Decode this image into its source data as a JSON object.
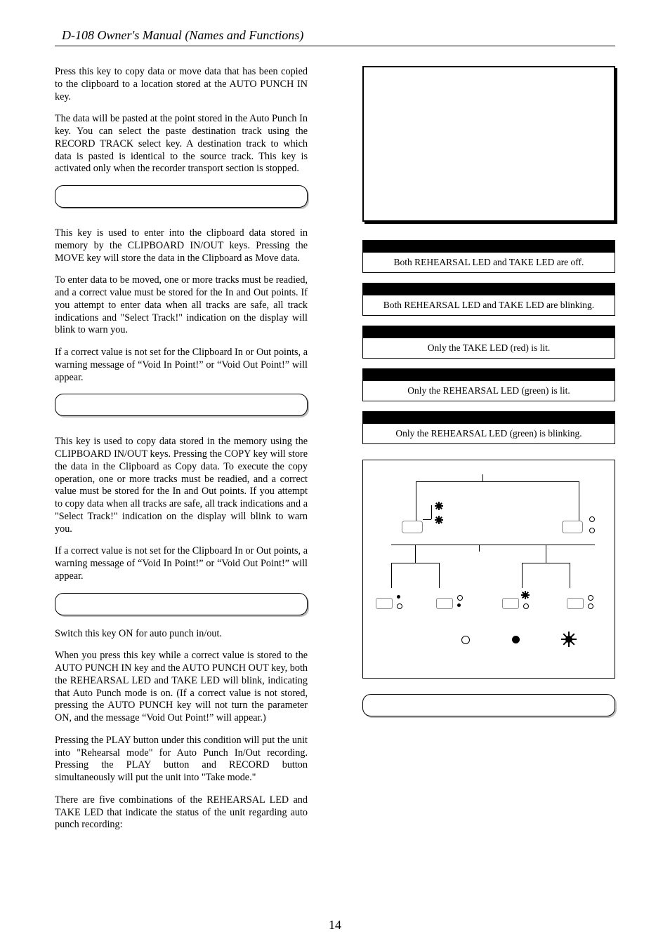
{
  "running_head": "D-108 Owner's Manual (Names and Functions)",
  "page_number": "14",
  "left": {
    "p1": "Press this key to copy data or move data that has been copied to the clipboard to a location stored at the AUTO PUNCH IN key.",
    "p2": "The data will be pasted at the point stored in the Auto Punch In key.  You can select the paste destination track using the RECORD TRACK select key.  A destination track to which data is pasted is identical to the source track. This key is activated only when the recorder transport section is stopped.",
    "p3": "This key is used to enter into the clipboard data stored in memory by the CLIPBOARD IN/OUT keys.  Pressing the MOVE key will store the data in the Clipboard as Move data.",
    "p4": "To enter data to be moved, one or more tracks must be readied, and a correct value must be stored for the In and Out points.  If you attempt to enter data when all tracks are safe, all track indications and \"Select Track!\" indication on the display will blink to warn you.",
    "p5": "If a correct value is not set for the Clipboard In or Out points, a warning message of “Void In Point!” or “Void Out Point!” will appear.",
    "p6": "This key is used to copy data stored in the memory using the CLIPBOARD IN/OUT keys.  Pressing the COPY key will store the data in the Clipboard as Copy data.  To execute the copy operation, one or more tracks must be readied, and a correct value must be stored for the In and Out points.  If you attempt to copy data when all tracks are safe, all track indications and a \"Select Track!\" indication on the display will blink to warn you.",
    "p7": "If a correct value is not set for the Clipboard In or Out points, a warning message of “Void In Point!” or “Void Out Point!” will appear.",
    "p8": "Switch this key ON for auto punch in/out.",
    "p9": "When you press this key while a correct value is stored to the AUTO PUNCH IN key and the AUTO PUNCH OUT key, both the REHEARSAL LED and TAKE LED will blink, indicating that Auto Punch mode is on. (If a correct value is not stored, pressing the AUTO PUNCH key will not turn the parameter ON, and the message “Void Out Point!” will appear.)",
    "p10": "Pressing the PLAY button under this condition will put the unit into \"Rehearsal mode\" for Auto Punch In/Out recording.  Pressing the PLAY button and RECORD button simultaneously will put the unit into \"Take mode.\"",
    "p11": "There are five combinations of the REHEARSAL LED and TAKE LED that indicate the status of the unit regarding auto punch recording:"
  },
  "right": {
    "status": [
      "Both REHEARSAL LED and TAKE LED are off.",
      "Both REHEARSAL LED and TAKE LED are blinking.",
      "Only the TAKE LED (red) is lit.",
      "Only the REHEARSAL LED (green) is lit.",
      "Only the REHEARSAL LED (green) is blinking."
    ]
  }
}
